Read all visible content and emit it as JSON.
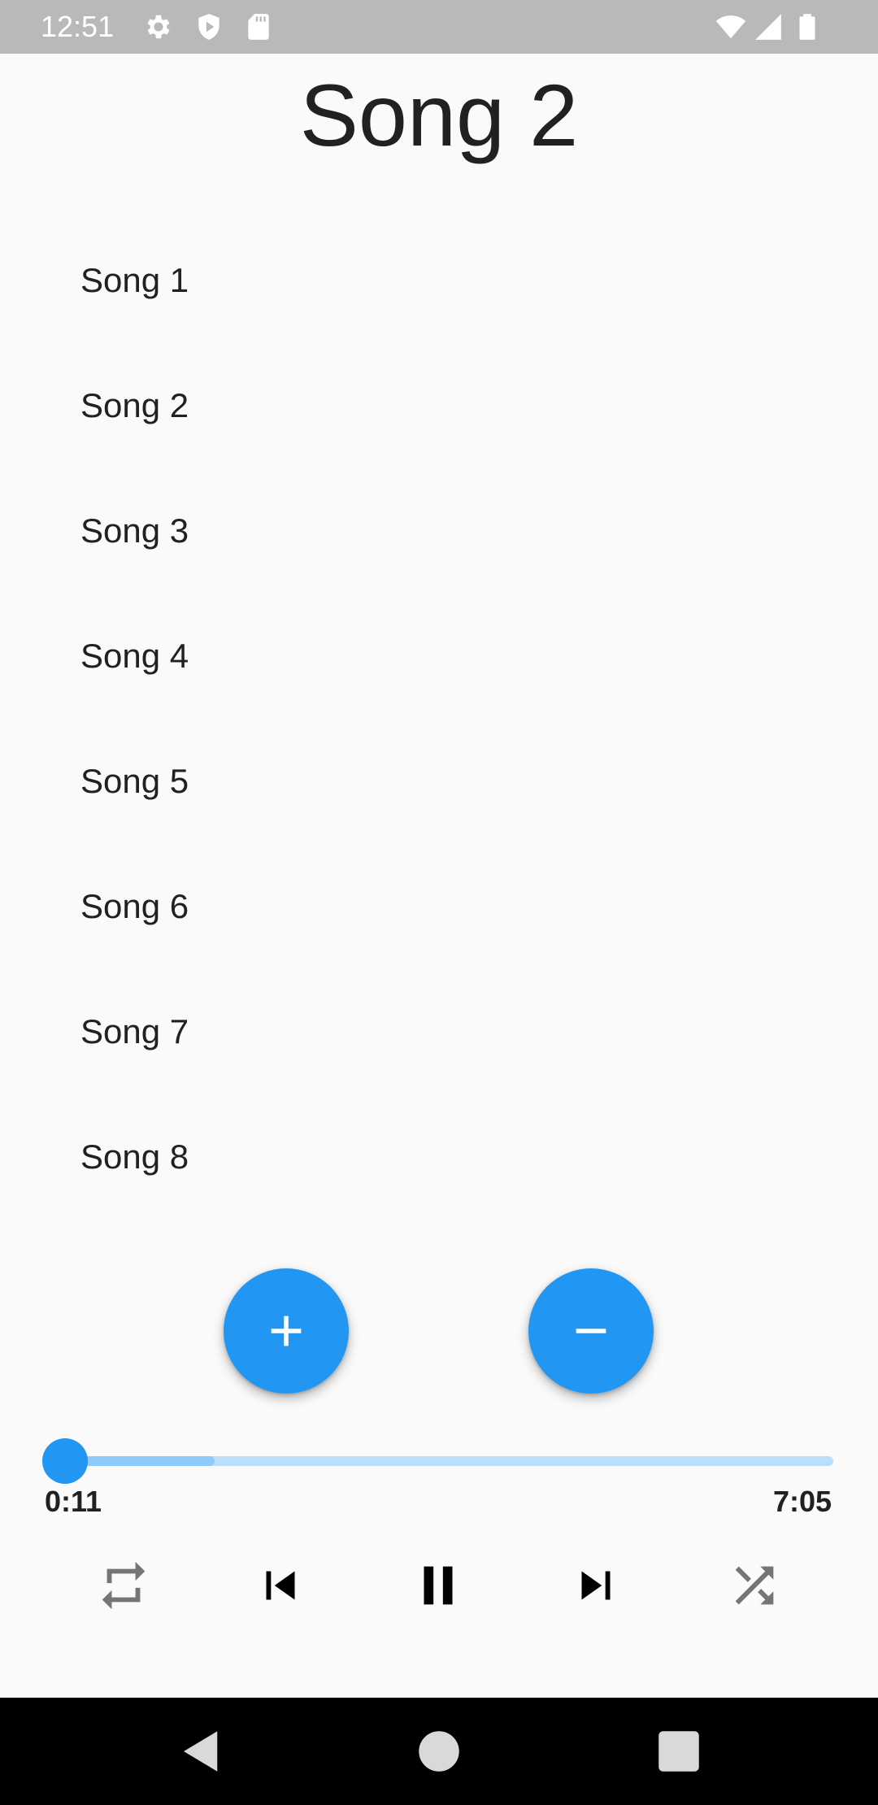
{
  "status_bar": {
    "time": "12:51",
    "left_icons": [
      "gear-icon",
      "shield-play-icon",
      "sd-card-icon"
    ],
    "right_icons": [
      "wifi-icon",
      "cellular-signal-icon",
      "battery-icon"
    ]
  },
  "now_playing": {
    "title": "Song 2"
  },
  "songs": [
    {
      "label": "Song 1"
    },
    {
      "label": "Song 2"
    },
    {
      "label": "Song 3"
    },
    {
      "label": "Song 4"
    },
    {
      "label": "Song 5"
    },
    {
      "label": "Song 6"
    },
    {
      "label": "Song 7"
    },
    {
      "label": "Song 8"
    }
  ],
  "actions": {
    "add_icon": "plus-icon",
    "remove_icon": "minus-icon"
  },
  "player": {
    "elapsed": "0:11",
    "total": "7:05",
    "progress_fraction": 0.026,
    "buffered_fraction": 0.215,
    "controls": [
      "repeat-icon",
      "skip-previous-icon",
      "pause-icon",
      "skip-next-icon",
      "shuffle-icon"
    ]
  },
  "colors": {
    "accent": "#2196F3",
    "track": "#BBDEFB",
    "buffer": "#90CAF9",
    "text": "#212121",
    "status_bar": "#B9B9B9",
    "nav_bar": "#000000",
    "background": "#FAFAFA"
  }
}
